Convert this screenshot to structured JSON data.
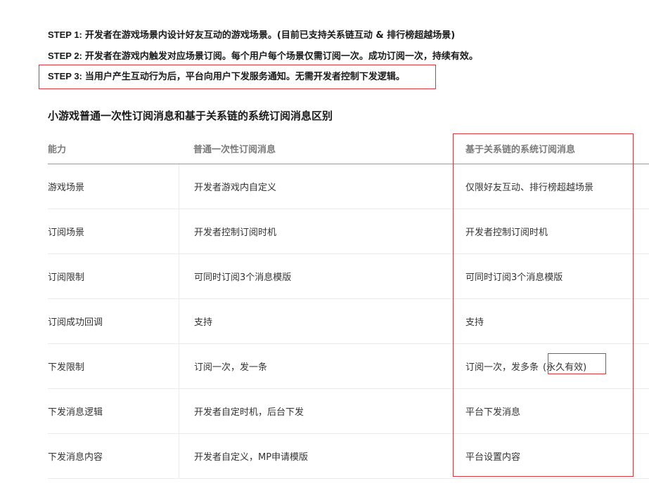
{
  "steps": [
    {
      "key": "STEP 1:",
      "text": "开发者在游戏场景内设计好友互动的游戏场景。(目前已支持关系链互动 & 排行榜超越场景)"
    },
    {
      "key": "STEP 2:",
      "text": "开发者在游戏内触发对应场景订阅。每个用户每个场景仅需订阅一次。成功订阅一次，持续有效。"
    },
    {
      "key": "STEP 3:",
      "text": "当用户产生互动行为后，平台向用户下发服务通知。无需开发者控制下发逻辑。"
    }
  ],
  "section_title": "小游戏普通一次性订阅消息和基于关系链的系统订阅消息区别",
  "table": {
    "headers": [
      "能力",
      "普通一次性订阅消息",
      "基于关系链的系统订阅消息"
    ],
    "rows": [
      [
        "游戏场景",
        "开发者游戏内自定义",
        "仅限好友互动、排行榜超越场景"
      ],
      [
        "订阅场景",
        "开发者控制订阅时机",
        "开发者控制订阅时机"
      ],
      [
        "订阅限制",
        "可同时订阅3个消息模版",
        "可同时订阅3个消息模版"
      ],
      [
        "订阅成功回调",
        "支持",
        "支持"
      ],
      [
        "下发限制",
        "订阅一次，发一条",
        "订阅一次，发多条"
      ],
      [
        "下发消息逻辑",
        "开发者自定时机，后台下发",
        "平台下发消息"
      ],
      [
        "下发消息内容",
        "开发者自定义，MP申请模版",
        "平台设置内容"
      ]
    ],
    "row5_col3_suffix": "(永久有效)"
  },
  "colors": {
    "highlight": "#d9363e",
    "text": "#333333",
    "header_text": "#7a7a7a"
  }
}
